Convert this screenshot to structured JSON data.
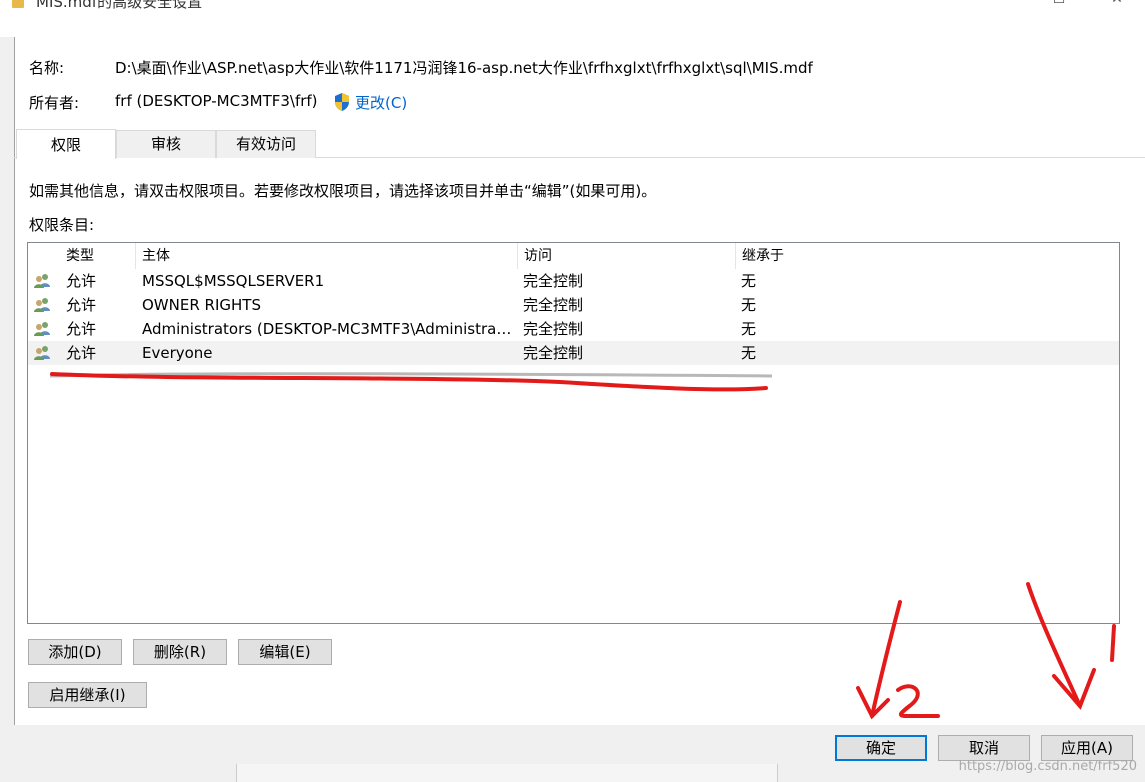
{
  "window": {
    "title": "MIS.mdf的高级安全设置"
  },
  "info": {
    "name_label": "名称:",
    "name_value": "D:\\桌面\\作业\\ASP.net\\asp大作业\\软件1171冯润锋16-asp.net大作业\\frfhxglxt\\frfhxglxt\\sql\\MIS.mdf",
    "owner_label": "所有者:",
    "owner_value": "frf (DESKTOP-MC3MTF3\\frf)",
    "change_link": "更改(C)"
  },
  "tabs": [
    {
      "label": "权限",
      "active": true
    },
    {
      "label": "审核",
      "active": false
    },
    {
      "label": "有效访问",
      "active": false
    }
  ],
  "instructions": "如需其他信息，请双击权限项目。若要修改权限项目，请选择该项目并单击“编辑”(如果可用)。",
  "entries_label": "权限条目:",
  "table": {
    "columns": [
      "类型",
      "主体",
      "访问",
      "继承于"
    ],
    "rows": [
      {
        "type": "允许",
        "principal": "MSSQL$MSSQLSERVER1",
        "access": "完全控制",
        "inherited": "无"
      },
      {
        "type": "允许",
        "principal": "OWNER RIGHTS",
        "access": "完全控制",
        "inherited": "无"
      },
      {
        "type": "允许",
        "principal": "Administrators (DESKTOP-MC3MTF3\\Administrat...",
        "access": "完全控制",
        "inherited": "无"
      },
      {
        "type": "允许",
        "principal": "Everyone",
        "access": "完全控制",
        "inherited": "无"
      }
    ]
  },
  "buttons": {
    "add": "添加(D)",
    "remove": "删除(R)",
    "edit": "编辑(E)",
    "enable_inheritance": "启用继承(I)",
    "ok": "确定",
    "cancel": "取消",
    "apply": "应用(A)"
  },
  "annotations": {
    "one": "1",
    "two": "2"
  },
  "watermark": "https://blog.csdn.net/frf520",
  "colors": {
    "accent": "#0078d7",
    "link": "#0066cc",
    "annotation": "#e41a1a"
  }
}
